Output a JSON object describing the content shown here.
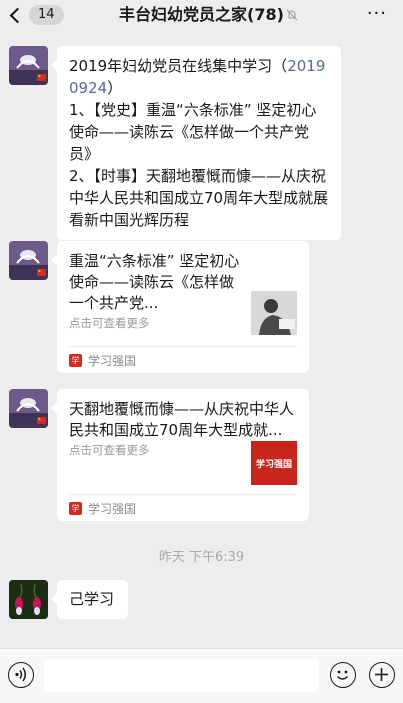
{
  "header": {
    "unread_count": "14",
    "title": "丰台妇幼党员之家(78)",
    "more": "···"
  },
  "messages": [
    {
      "type": "text",
      "line1": "2019年妇幼党员在线集中学习（",
      "link": "20190924",
      "line2": "）\n1、【党史】重温“六条标准” 坚定初心使命——读陈云《怎样做一个共产党员》\n2、【时事】天翻地覆慨而慷——从庆祝中华人民共和国成立70周年大型成就展看新中国光辉历程"
    },
    {
      "type": "card",
      "title": "重温“六条标准” 坚定初心使命——读陈云《怎样做一个共产党...",
      "sub": "点击可查看更多",
      "source": "学习强国"
    },
    {
      "type": "card",
      "title": "天翻地覆慨而慷——从庆祝中华人民共和国成立70周年大型成就...",
      "sub": "点击可查看更多",
      "source": "学习强国",
      "thumb_text": "学习强国"
    }
  ],
  "timestamp": "昨天 下午6:39",
  "reply": {
    "text": "己学习"
  },
  "colors": {
    "background": "#ededed",
    "link": "#576b95",
    "brand_red": "#d9271c"
  }
}
